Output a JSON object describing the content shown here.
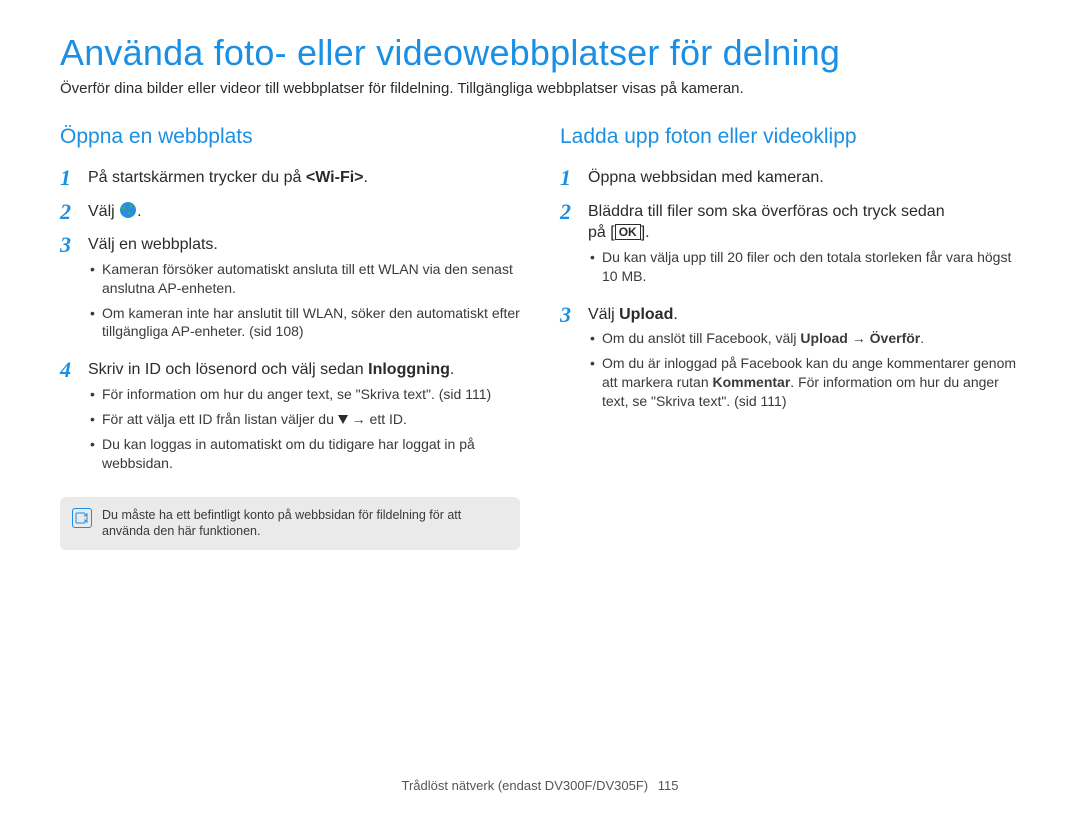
{
  "title": "Använda foto- eller videowebbplatser för delning",
  "intro": "Överför dina bilder eller videor till webbplatser för fildelning. Tillgängliga webbplatser visas på kameran.",
  "left": {
    "heading": "Öppna en webbplats",
    "step1_num": "1",
    "step1_pre": "På startskärmen trycker du på ",
    "step1_bold": "<Wi-Fi>",
    "step1_post": ".",
    "step2_num": "2",
    "step2_pre": "Välj ",
    "globe_name": "globe-icon",
    "step2_post": ".",
    "step3_num": "3",
    "step3_text": "Välj en webbplats.",
    "step3_b1": "Kameran försöker automatiskt ansluta till ett WLAN via den senast anslutna AP-enheten.",
    "step3_b2": "Om kameran inte har anslutit till WLAN, söker den automatiskt efter tillgängliga AP-enheter. (sid 108)",
    "step4_num": "4",
    "step4_pre": "Skriv in ID och lösenord och välj sedan ",
    "step4_bold": "Inloggning",
    "step4_post": ".",
    "step4_b1": "För information om hur du anger text, se \"Skriva text\". (sid 111)",
    "step4_b2_pre": "För att välja ett ID från listan väljer du ",
    "step4_b2_post": " → ett ID.",
    "step4_b3": "Du kan loggas in automatiskt om du tidigare har loggat in på webbsidan.",
    "note": "Du måste ha ett befintligt konto på webbsidan för fildelning för att använda den här funktionen."
  },
  "right": {
    "heading": "Ladda upp foton eller videoklipp",
    "step1_num": "1",
    "step1_text": "Öppna webbsidan med kameran.",
    "step2_num": "2",
    "step2_line1": "Bläddra till filer som ska överföras och tryck sedan",
    "step2_line2_pre": "på [",
    "ok_label": "OK",
    "step2_line2_post": "].",
    "step2_b1": "Du kan välja upp till 20 filer och den totala storleken får vara högst 10 MB.",
    "step3_num": "3",
    "step3_pre": "Välj ",
    "step3_bold": "Upload",
    "step3_post": ".",
    "step3_b1_pre": "Om du anslöt till Facebook, välj ",
    "step3_b1_bold1": "Upload",
    "step3_b1_mid": " → ",
    "step3_b1_bold2": "Överför",
    "step3_b1_post": ".",
    "step3_b2_pre": "Om du är inloggad på Facebook kan du ange kommentarer genom att markera rutan ",
    "step3_b2_bold": "Kommentar",
    "step3_b2_post": ". För information om hur du anger text, se \"Skriva text\". (sid 111)"
  },
  "footer_text": "Trådlöst nätverk (endast DV300F/DV305F)",
  "page_number": "115"
}
